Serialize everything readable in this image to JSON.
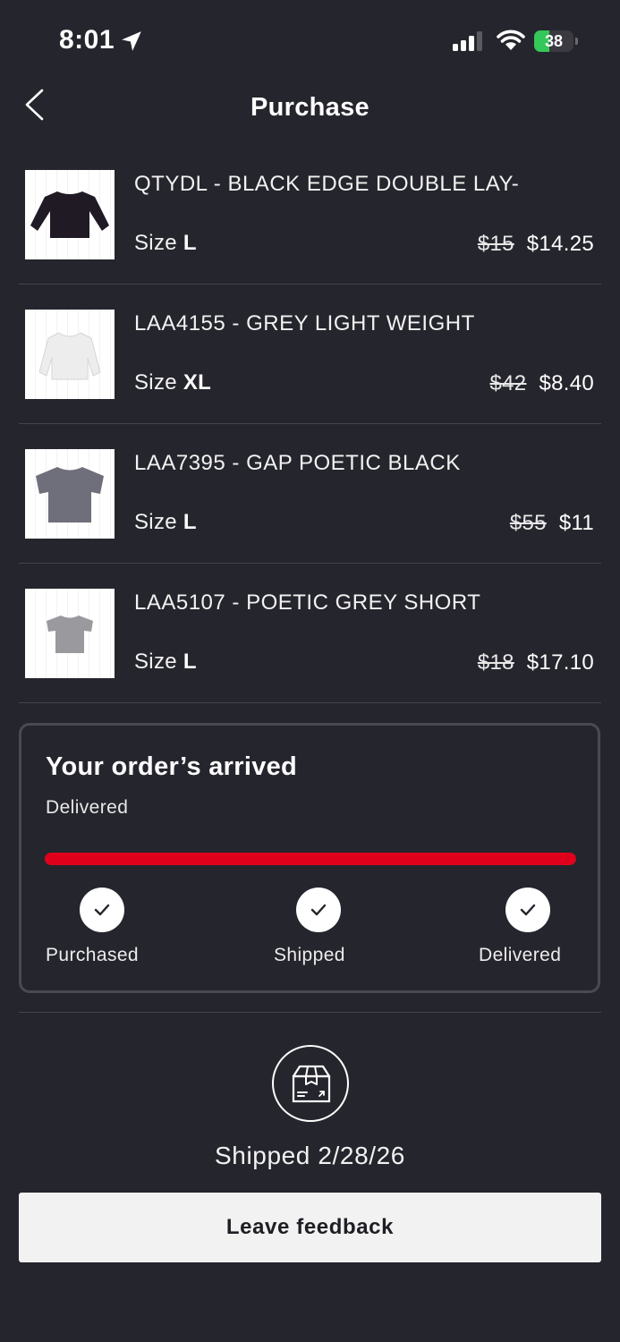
{
  "status_bar": {
    "time": "8:01",
    "battery": "38",
    "battery_level": 0.38
  },
  "header": {
    "title": "Purchase"
  },
  "items": [
    {
      "title": "QTYDL - BLACK EDGE DOUBLE LAY-",
      "size_label": "Size",
      "size": "L",
      "original_price": "$15",
      "price": "$14.25"
    },
    {
      "title": "LAA4155 - GREY LIGHT WEIGHT",
      "size_label": "Size",
      "size": "XL",
      "original_price": "$42",
      "price": "$8.40"
    },
    {
      "title": "LAA7395 - GAP POETIC BLACK",
      "size_label": "Size",
      "size": "L",
      "original_price": "$55",
      "price": "$11"
    },
    {
      "title": "LAA5107 - POETIC GREY SHORT",
      "size_label": "Size",
      "size": "L",
      "original_price": "$18",
      "price": "$17.10"
    }
  ],
  "order": {
    "title": "Your order’s arrived",
    "status": "Delivered",
    "progress": 1.0,
    "steps": [
      {
        "label": "Purchased",
        "done": true
      },
      {
        "label": "Shipped",
        "done": true
      },
      {
        "label": "Delivered",
        "done": true
      }
    ]
  },
  "shipment": {
    "text": "Shipped 2/28/26"
  },
  "actions": {
    "feedback_label": "Leave feedback"
  },
  "colors": {
    "background": "#25252d",
    "accent": "#e0001b",
    "battery": "#34c759"
  }
}
